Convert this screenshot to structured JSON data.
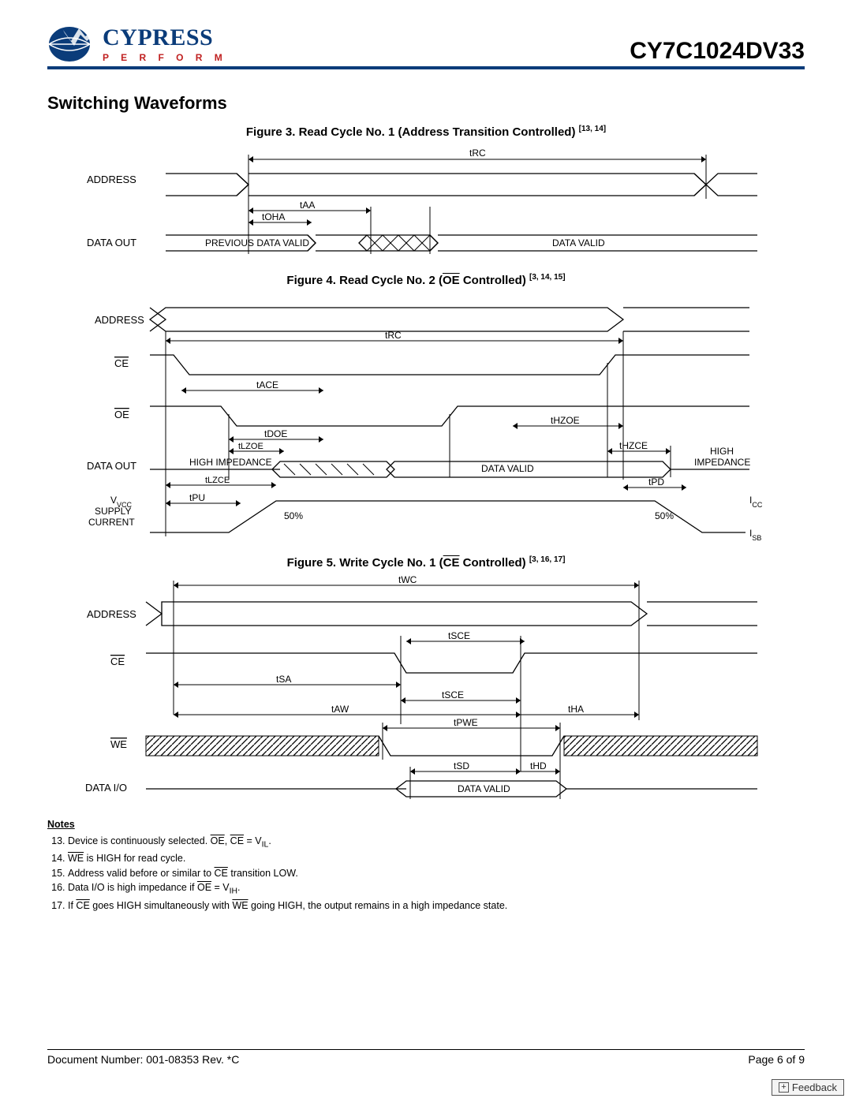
{
  "header": {
    "brand_main": "CYPRESS",
    "brand_sub": "P E R F O R M",
    "part_number": "CY7C1024DV33"
  },
  "section_title": "Switching Waveforms",
  "figures": {
    "fig3": {
      "caption_prefix": "Figure 3.  Read Cycle No. 1 (Address Transition Controlled) ",
      "caption_refs": "[13, 14]",
      "signals": {
        "address": "ADDRESS",
        "data_out": "DATA OUT"
      },
      "timings": {
        "trc": "tRC",
        "taa": "tAA",
        "toha": "tOHA"
      },
      "text": {
        "prev_valid": "PREVIOUS DATA VALID",
        "data_valid": "DATA VALID"
      }
    },
    "fig4": {
      "caption_prefix": "Figure 4.  Read Cycle No. 2 (",
      "caption_oe": "OE",
      "caption_suffix": " Controlled) ",
      "caption_refs": "[3, 14, 15]",
      "signals": {
        "address": "ADDRESS",
        "ce": "CE",
        "oe": "OE",
        "data_out": "DATA  OUT",
        "vcc": "VCC",
        "supply": "SUPPLY",
        "current": "CURRENT",
        "icc": "ICC",
        "isb": "ISB"
      },
      "timings": {
        "trc": "tRC",
        "tace": "tACE",
        "tdoe": "tDOE",
        "tlzoe": "tLZOE",
        "tlzce": "tLZCE",
        "thzoe": "tHZOE",
        "thzce": "tHZCE",
        "tpu": "tPU",
        "tpd": "tPD"
      },
      "text": {
        "high_imp": "HIGH IMPEDANCE",
        "high_imp2a": "HIGH",
        "high_imp2b": "IMPEDANCE",
        "data_valid": "DATA VALID",
        "fifty": "50%"
      }
    },
    "fig5": {
      "caption_prefix": "Figure 5.  Write Cycle No. 1 (",
      "caption_ce": "CE",
      "caption_suffix": " Controlled) ",
      "caption_refs": "[3, 16, 17]",
      "signals": {
        "address": "ADDRESS",
        "ce": "CE",
        "we": "WE",
        "dataio": "DATA I/O"
      },
      "timings": {
        "twc": "tWC",
        "tsce": "tSCE",
        "tsa": "tSA",
        "taw": "tAW",
        "tha": "tHA",
        "tpwe": "tPWE",
        "tsd": "tSD",
        "thd": "tHD"
      },
      "text": {
        "data_valid": "DATA VALID"
      }
    }
  },
  "notes": {
    "title": "Notes",
    "n13_a": "Device is continuously selected. ",
    "n13_b": "OE",
    "n13_c": ", ",
    "n13_d": "CE",
    "n13_e": " = V",
    "n13_f": "IL",
    "n13_g": ".",
    "n14_a": "WE",
    "n14_b": " is HIGH for read cycle.",
    "n15_a": "Address valid before or similar to ",
    "n15_b": "CE",
    "n15_c": " transition LOW.",
    "n16_a": "Data I/O is high impedance if ",
    "n16_b": "OE",
    "n16_c": " = V",
    "n16_d": "IH",
    "n16_e": ".",
    "n17_a": "If ",
    "n17_b": "CE",
    "n17_c": " goes HIGH simultaneously with ",
    "n17_d": "WE",
    "n17_e": " going HIGH, the output remains in a high impedance state."
  },
  "footer": {
    "doc": "Document Number: 001-08353 Rev. *C",
    "page": "Page 6 of 9",
    "feedback": "Feedback"
  }
}
